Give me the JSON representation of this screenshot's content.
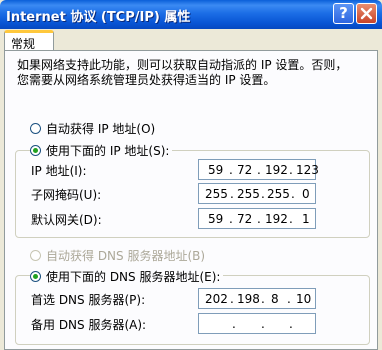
{
  "window": {
    "title": "Internet 协议 (TCP/IP) 属性",
    "help_label": "?",
    "close_label": "×"
  },
  "tabs": [
    {
      "label": "常规"
    }
  ],
  "description": {
    "line1": "如果网络支持此功能，则可以获取自动指派的 IP 设置。否则，",
    "line2": "您需要从网络系统管理员处获得适当的 IP 设置。"
  },
  "ip_section": {
    "auto_label": "自动获得 IP 地址(O)",
    "manual_label": "使用下面的 IP 地址(S):",
    "selected": "manual",
    "fields": [
      {
        "label": "IP 地址(I):",
        "octets": [
          "59",
          "72",
          "192",
          "123"
        ]
      },
      {
        "label": "子网掩码(U):",
        "octets": [
          "255",
          "255",
          "255",
          "0"
        ]
      },
      {
        "label": "默认网关(D):",
        "octets": [
          "59",
          "72",
          "192",
          "1"
        ]
      }
    ]
  },
  "dns_section": {
    "auto_label": "自动获得 DNS 服务器地址(B)",
    "auto_disabled": true,
    "manual_label": "使用下面的 DNS 服务器地址(E):",
    "selected": "manual",
    "fields": [
      {
        "label": "首选 DNS 服务器(P):",
        "octets": [
          "202",
          "198",
          "8",
          "10"
        ]
      },
      {
        "label": "备用 DNS 服务器(A):",
        "octets": [
          "",
          "",
          "",
          ""
        ]
      }
    ]
  }
}
